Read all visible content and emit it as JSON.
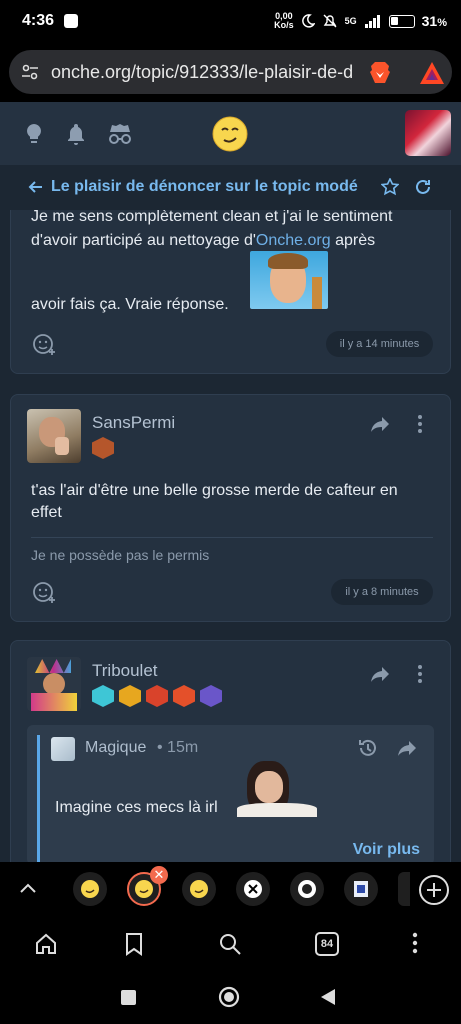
{
  "status_bar": {
    "time": "4:36",
    "net_speed": "0,00",
    "net_unit": "Ko/s",
    "signal": "5G",
    "battery": "31",
    "battery_unit": "%"
  },
  "browser": {
    "url": "onche.org/topic/912333/le-plaisir-de-d",
    "tab_count": "84"
  },
  "topic": {
    "title": "Le plaisir de dénoncer sur le topic modé"
  },
  "posts": [
    {
      "text_line1": "Je me sens complètement clean et j'ai le sentiment",
      "text_line2_prefix": "d'avoir participé au nettoyage d'",
      "text_line2_link": "Onche.org",
      "text_line2_suffix": " après",
      "text_line3": "avoir fais ça. Vraie réponse.",
      "time": "il y a 14 minutes"
    },
    {
      "username": "SansPermi",
      "text_line1": "t'as l'air d'être une belle grosse merde de cafteur en",
      "text_line2": "effet",
      "signature": "Je ne possède pas le permis",
      "time": "il y a 8 minutes"
    },
    {
      "username": "Triboulet",
      "quote": {
        "author": "Magique",
        "time": "• 15m",
        "text": "Imagine ces mecs là irl",
        "more": "Voir plus"
      }
    }
  ],
  "colors": {
    "accent": "#78b9ee",
    "background": "#1c2733",
    "card": "#243140",
    "header": "#253241"
  }
}
